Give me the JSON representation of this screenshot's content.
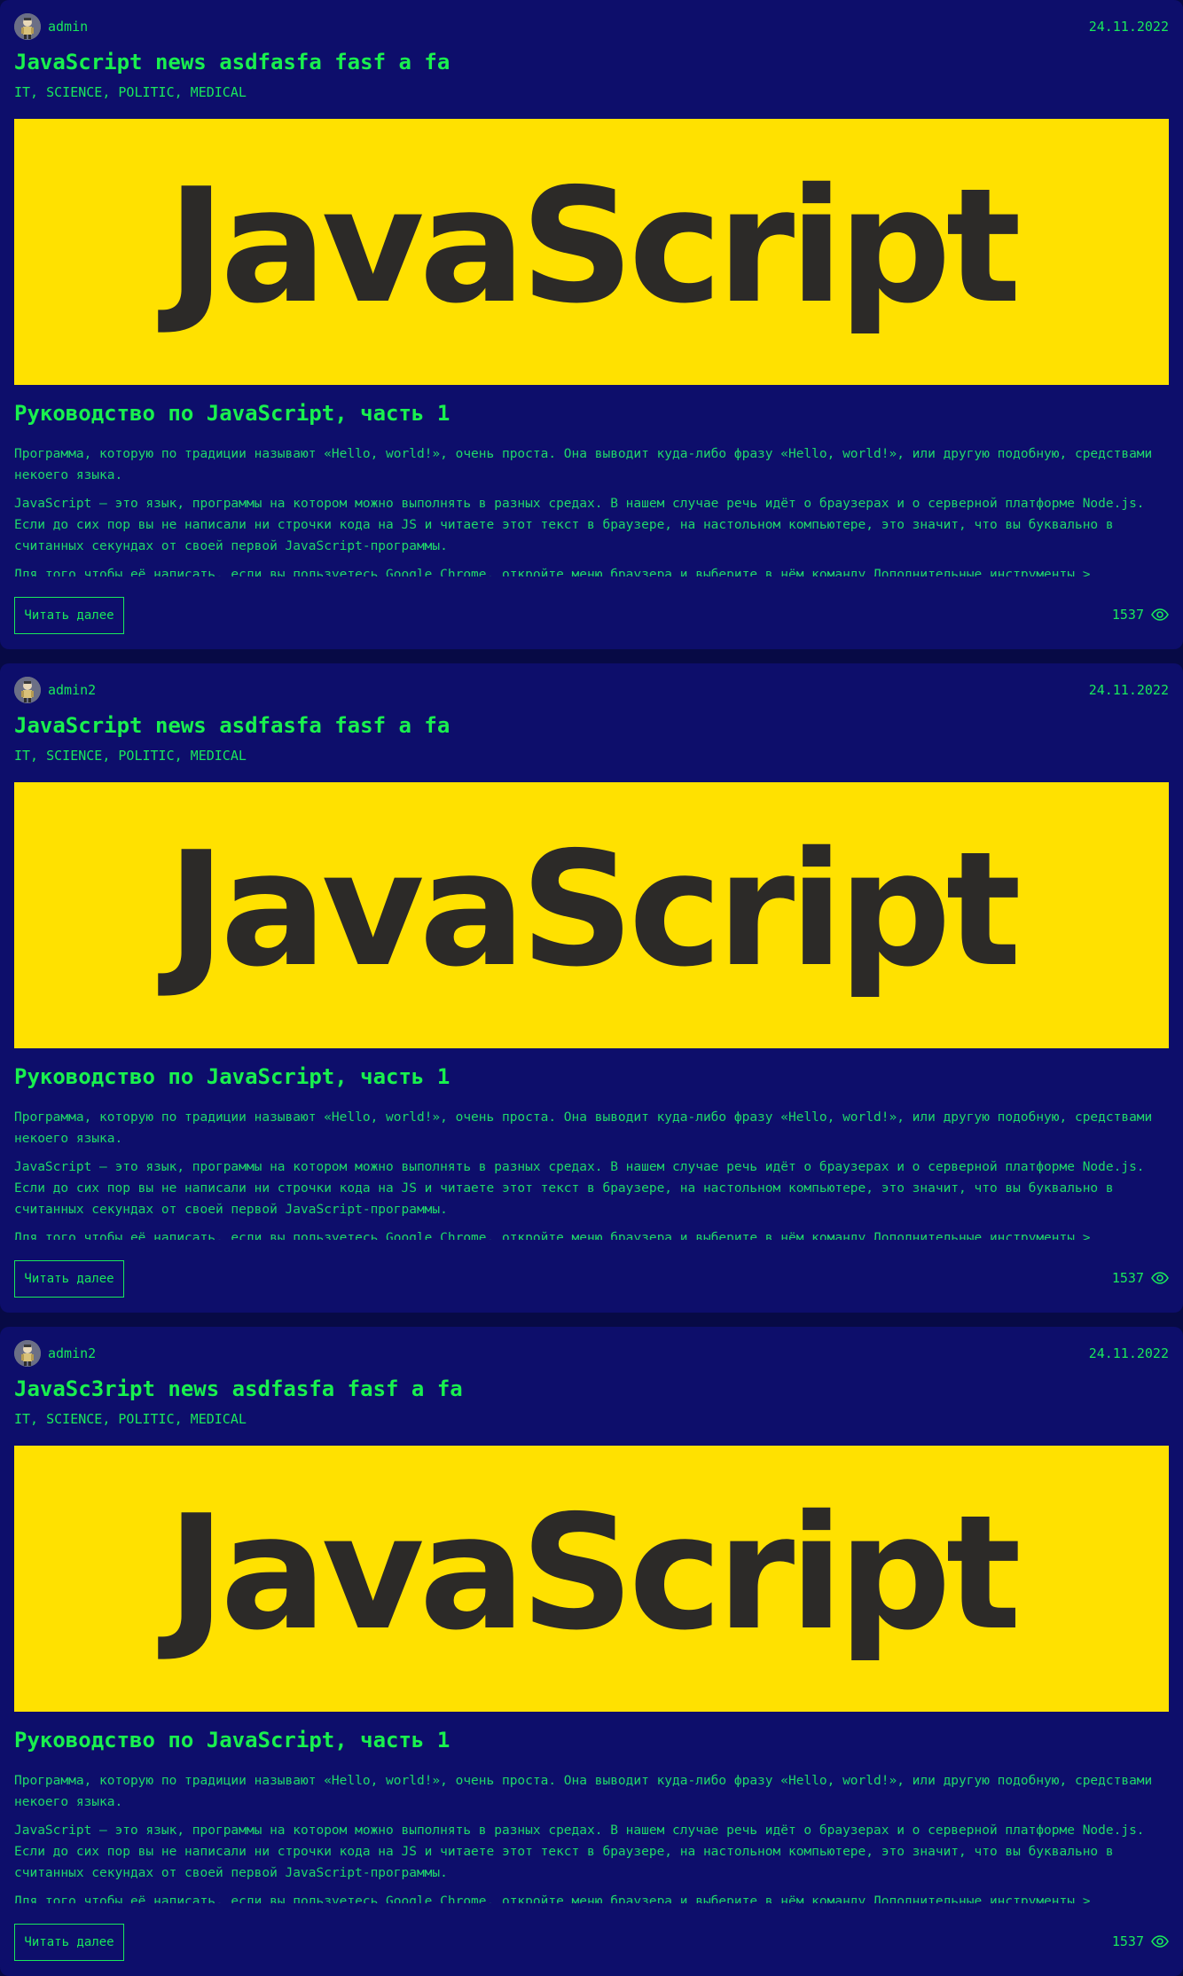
{
  "colors": {
    "page_bg": "#070a45",
    "card_bg": "#0d0e6b",
    "accent_green": "#19f04e",
    "text_green": "#1fd86a",
    "image_bg": "#ffe100",
    "logo_text": "#2c2a28"
  },
  "posts": [
    {
      "author": "admin",
      "date": "24.11.2022",
      "title": "JavaScript news asdfasfa fasf a fa",
      "tags": "IT, SCIENCE, POLITIC, MEDICAL",
      "image_text": "JavaScript",
      "heading": "Руководство по JavaScript, часть 1",
      "paragraphs": [
        "Программа, которую по традиции называют «Hello, world!», очень проста. Она выводит куда-либо фразу «Hello, world!», или другую подобную, средствами некоего языка.",
        "JavaScript — это язык, программы на котором можно выполнять в разных средах. В нашем случае речь идёт о браузерах и о серверной платформе Node.js. Если до сих пор вы не написали ни строчки кода на JS и читаете этот текст в браузере, на настольном компьютере, это значит, что вы буквально в считанных секундах от своей первой JavaScript-программы.",
        "Для того чтобы её написать, если вы пользуетесь Google Chrome, откройте меню браузера и выберите в нём команду Дополнительные инструменты >"
      ],
      "read_more": "Читать далее",
      "views": "1537",
      "avatar_icon": "avatar-icon",
      "views_icon": "eye-icon"
    },
    {
      "author": "admin2",
      "date": "24.11.2022",
      "title": "JavaScript news asdfasfa fasf a fa",
      "tags": "IT, SCIENCE, POLITIC, MEDICAL",
      "image_text": "JavaScript",
      "heading": "Руководство по JavaScript, часть 1",
      "paragraphs": [
        "Программа, которую по традиции называют «Hello, world!», очень проста. Она выводит куда-либо фразу «Hello, world!», или другую подобную, средствами некоего языка.",
        "JavaScript — это язык, программы на котором можно выполнять в разных средах. В нашем случае речь идёт о браузерах и о серверной платформе Node.js. Если до сих пор вы не написали ни строчки кода на JS и читаете этот текст в браузере, на настольном компьютере, это значит, что вы буквально в считанных секундах от своей первой JavaScript-программы.",
        "Для того чтобы её написать, если вы пользуетесь Google Chrome, откройте меню браузера и выберите в нём команду Дополнительные инструменты >"
      ],
      "read_more": "Читать далее",
      "views": "1537",
      "avatar_icon": "avatar-icon",
      "views_icon": "eye-icon"
    },
    {
      "author": "admin2",
      "date": "24.11.2022",
      "title": "JavaSc3ript news asdfasfa fasf a fa",
      "tags": "IT, SCIENCE, POLITIC, MEDICAL",
      "image_text": "JavaScript",
      "heading": "Руководство по JavaScript, часть 1",
      "paragraphs": [
        "Программа, которую по традиции называют «Hello, world!», очень проста. Она выводит куда-либо фразу «Hello, world!», или другую подобную, средствами некоего языка.",
        "JavaScript — это язык, программы на котором можно выполнять в разных средах. В нашем случае речь идёт о браузерах и о серверной платформе Node.js. Если до сих пор вы не написали ни строчки кода на JS и читаете этот текст в браузере, на настольном компьютере, это значит, что вы буквально в считанных секундах от своей первой JavaScript-программы.",
        "Для того чтобы её написать, если вы пользуетесь Google Chrome, откройте меню браузера и выберите в нём команду Дополнительные инструменты >"
      ],
      "read_more": "Читать далее",
      "views": "1537",
      "avatar_icon": "avatar-icon",
      "views_icon": "eye-icon"
    }
  ]
}
